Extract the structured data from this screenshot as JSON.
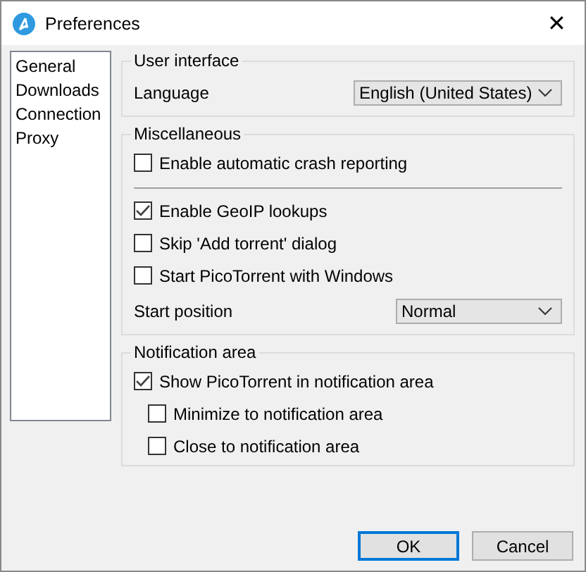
{
  "window": {
    "title": "Preferences",
    "close": "✕"
  },
  "sidebar": {
    "items": [
      {
        "label": "General",
        "selected": false
      },
      {
        "label": "Downloads",
        "selected": false
      },
      {
        "label": "Connection",
        "selected": false
      },
      {
        "label": "Proxy",
        "selected": false
      }
    ]
  },
  "groups": [
    {
      "title": "User interface",
      "items": [
        {
          "kind": "select",
          "label": "Language",
          "value": "English (United States)",
          "wide": true
        }
      ]
    },
    {
      "title": "Miscellaneous",
      "items": [
        {
          "kind": "checkbox",
          "label": "Enable automatic crash reporting",
          "checked": false
        },
        {
          "kind": "separator"
        },
        {
          "kind": "checkbox",
          "label": "Enable GeoIP lookups",
          "checked": true
        },
        {
          "kind": "checkbox",
          "label": "Skip 'Add torrent' dialog",
          "checked": false
        },
        {
          "kind": "checkbox",
          "label": "Start PicoTorrent with Windows",
          "checked": false
        },
        {
          "kind": "select",
          "label": "Start position",
          "value": "Normal",
          "wide": false
        }
      ]
    },
    {
      "title": "Notification area",
      "items": [
        {
          "kind": "checkbox",
          "label": "Show PicoTorrent in notification area",
          "checked": true,
          "children": [
            {
              "kind": "checkbox",
              "label": "Minimize to notification area",
              "checked": false
            },
            {
              "kind": "checkbox",
              "label": "Close to notification area",
              "checked": false
            }
          ]
        }
      ]
    }
  ],
  "buttons": [
    {
      "label": "OK",
      "default": true
    },
    {
      "label": "Cancel",
      "default": false
    }
  ]
}
